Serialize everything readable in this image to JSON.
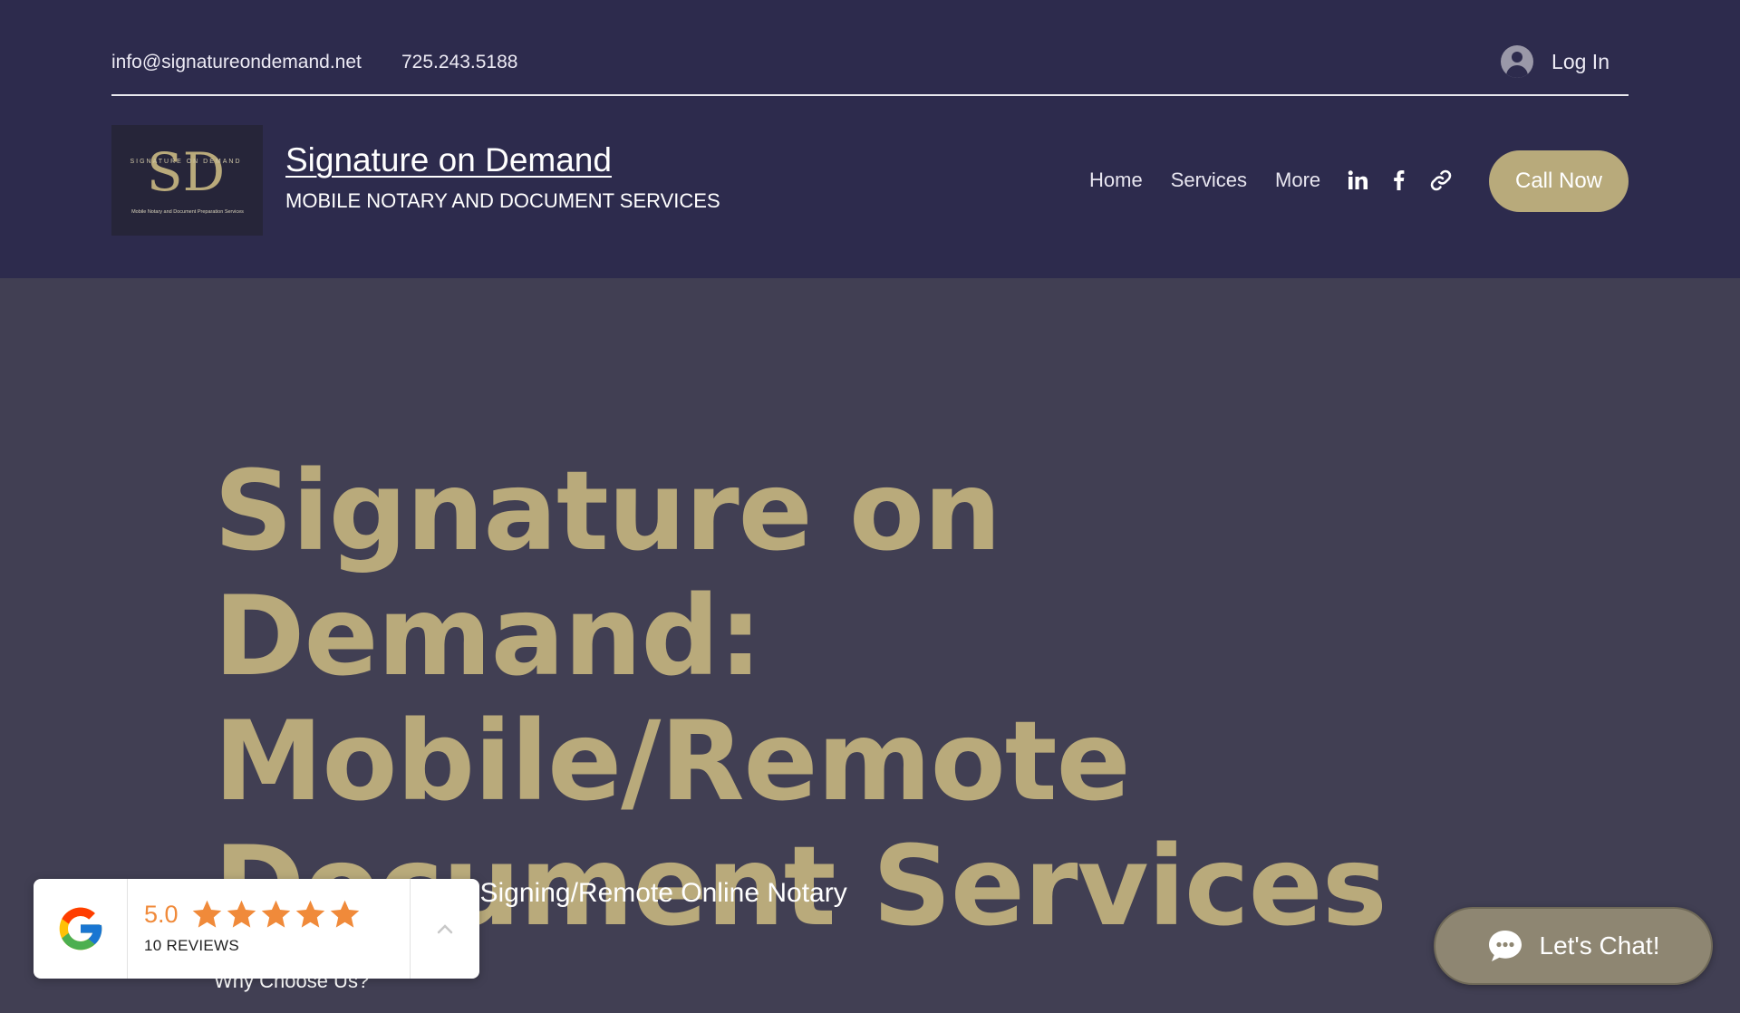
{
  "topbar": {
    "email": "info@signatureondemand.net",
    "phone": "725.243.5188",
    "login_label": "Log In"
  },
  "brand": {
    "logo_text_top": "SIGNATURE ON DEMAND",
    "logo_monogram": "SD",
    "logo_text_bottom": "Mobile Notary and Document Preparation Services",
    "title": "Signature on Demand",
    "tagline": "MOBILE NOTARY AND DOCUMENT SERVICES"
  },
  "nav": {
    "items": [
      {
        "label": "Home"
      },
      {
        "label": "Services"
      },
      {
        "label": "More"
      }
    ],
    "social_icons": [
      "linkedin-icon",
      "facebook-icon",
      "link-icon"
    ],
    "cta_label": "Call Now"
  },
  "hero": {
    "title": "Signature on Demand: Mobile/Remote Document Services",
    "subtitle": "n/Mobile Notary/Loan Signing/Remote Online Notary",
    "why_heading": "Why Choose Us?"
  },
  "review_widget": {
    "score": "5.0",
    "stars": 5,
    "count_label": "10 REVIEWS"
  },
  "chat": {
    "label": "Let's Chat!"
  },
  "colors": {
    "header_bg": "#2d2b4d",
    "page_bg": "#413f53",
    "gold": "#b9aa7b",
    "star_orange": "#f08a3a",
    "chat_bg": "#8e8672"
  }
}
